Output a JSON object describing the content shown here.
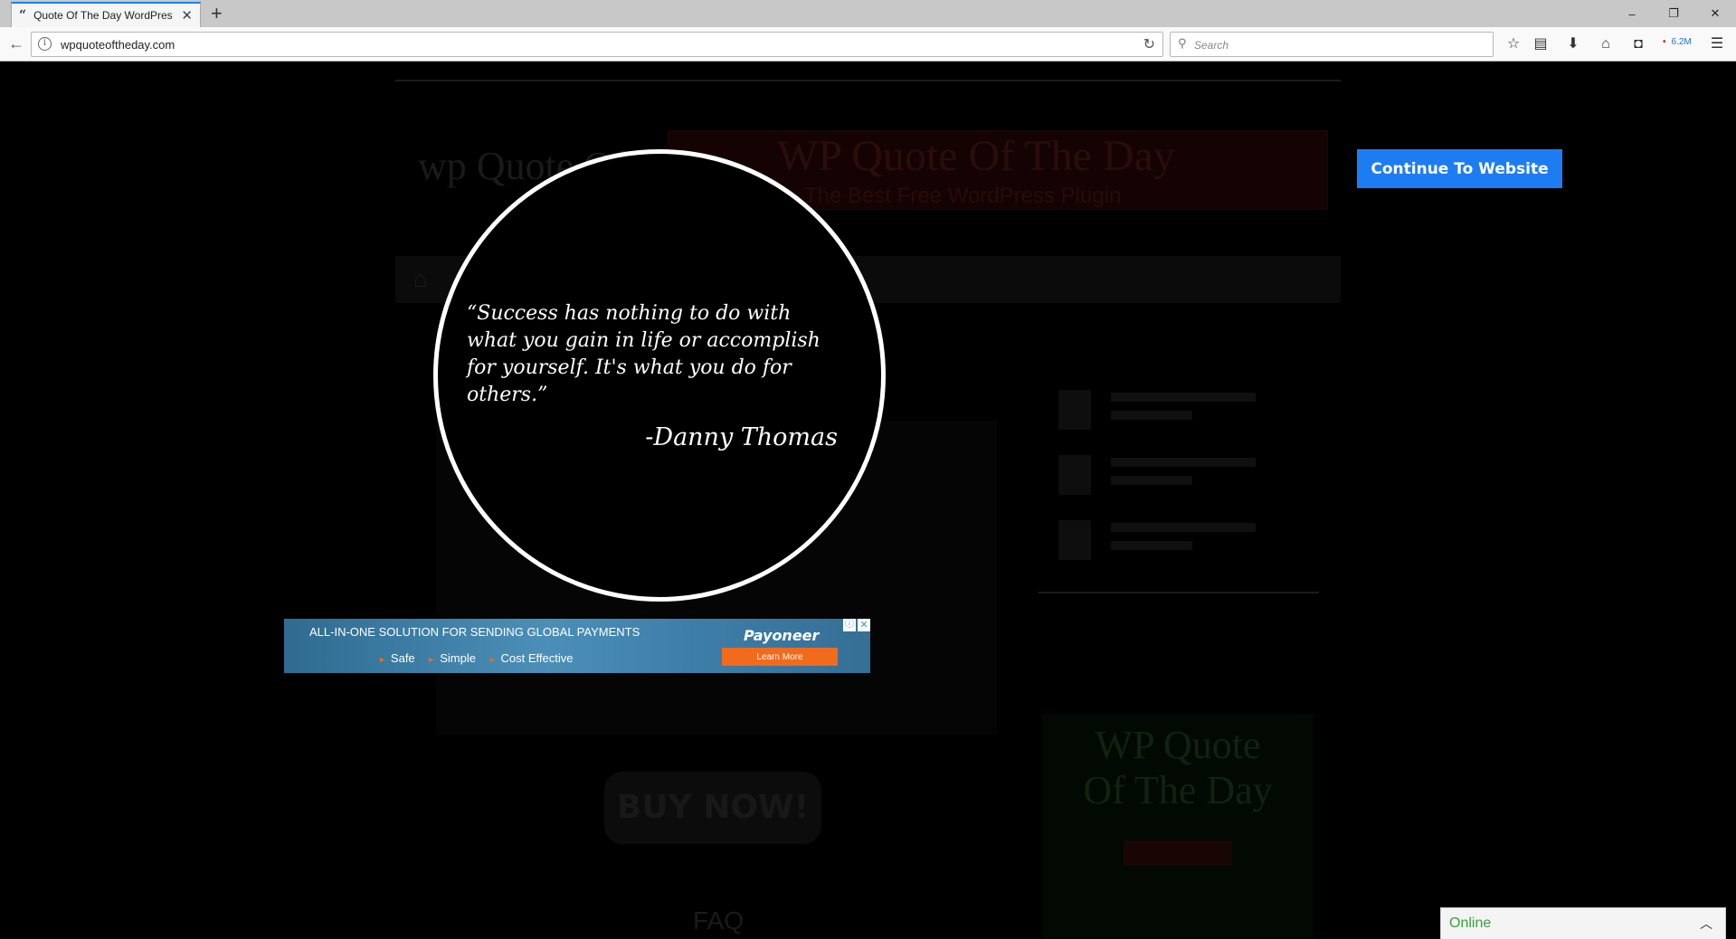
{
  "browser": {
    "tab_title": "Quote Of The Day WordPres",
    "tab_favicon": "“",
    "new_tab": "+",
    "url": "wpquoteoftheday.com",
    "search_placeholder": "Search",
    "addon_badge": "6.2M",
    "window_controls": {
      "minimize": "–",
      "restore": "❐",
      "close": "✕"
    },
    "toolbar_icons": [
      "star-icon",
      "reading-list-icon",
      "download-icon",
      "home-icon",
      "pocket-icon",
      "addon-icon",
      "menu-icon"
    ]
  },
  "page": {
    "site_logo": "wp Quote Of The Day",
    "banner_title": "WP Quote Of The Day",
    "banner_subtitle": "The Best Free WordPress Plugin",
    "buy_now": "BUY NOW!",
    "faq": "FAQ"
  },
  "overlay": {
    "continue_button": "Continue To Website",
    "quote": "“Success has nothing to do with what you gain in life or accomplish for yourself. It's what you do for others.”",
    "author": "-Danny Thomas"
  },
  "ad": {
    "headline": "ALL-IN-ONE SOLUTION FOR SENDING GLOBAL PAYMENTS",
    "bullets": [
      "Safe",
      "Simple",
      "Cost Effective"
    ],
    "brand": "Payoneer",
    "cta": "Learn More"
  },
  "chat": {
    "status": "Online",
    "status_color": "#3aa03a"
  },
  "colors": {
    "accent": "#1e7cf2",
    "ad_orange": "#f26a1b",
    "ad_blue": "#3d7ea8"
  }
}
